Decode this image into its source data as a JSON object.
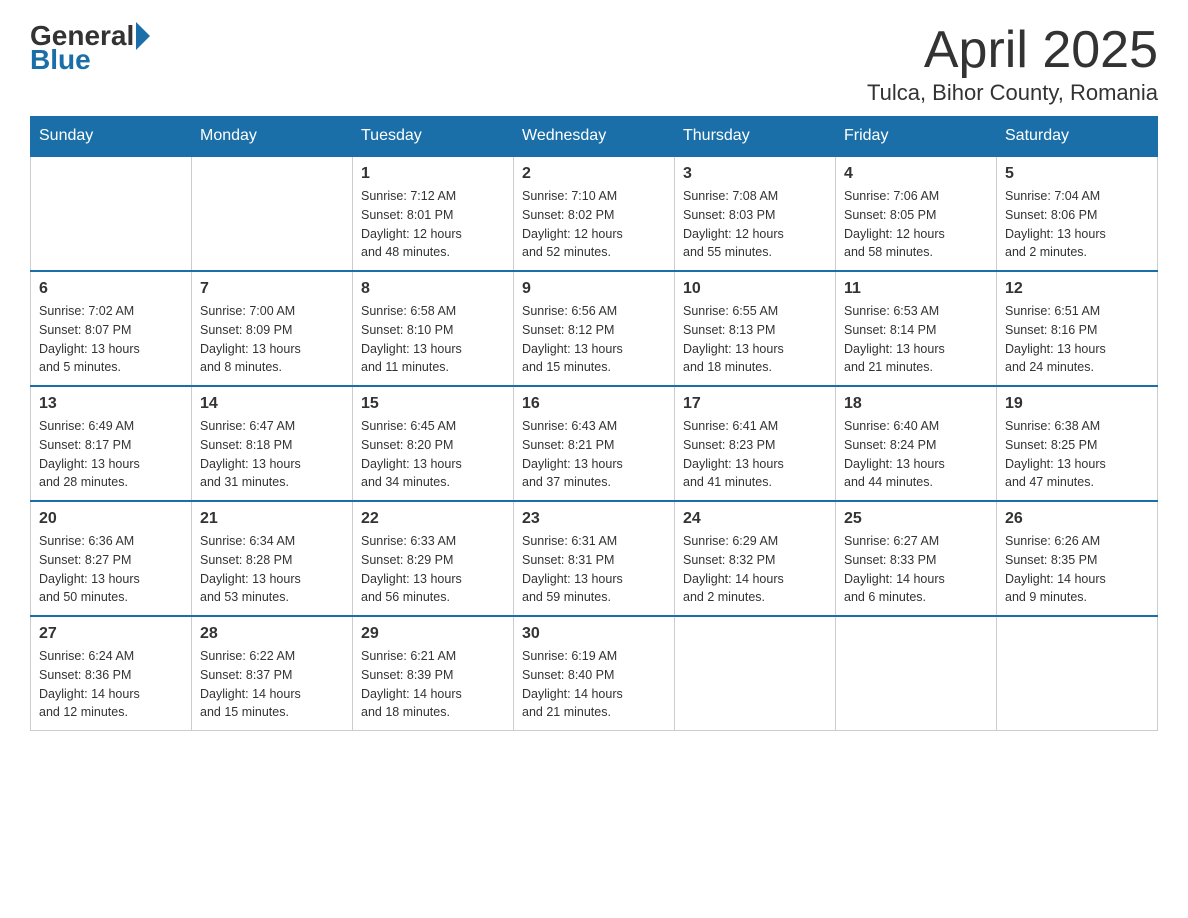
{
  "header": {
    "logo_general": "General",
    "logo_blue": "Blue",
    "month_title": "April 2025",
    "location": "Tulca, Bihor County, Romania"
  },
  "days_of_week": [
    "Sunday",
    "Monday",
    "Tuesday",
    "Wednesday",
    "Thursday",
    "Friday",
    "Saturday"
  ],
  "weeks": [
    [
      {
        "day": "",
        "info": ""
      },
      {
        "day": "",
        "info": ""
      },
      {
        "day": "1",
        "info": "Sunrise: 7:12 AM\nSunset: 8:01 PM\nDaylight: 12 hours\nand 48 minutes."
      },
      {
        "day": "2",
        "info": "Sunrise: 7:10 AM\nSunset: 8:02 PM\nDaylight: 12 hours\nand 52 minutes."
      },
      {
        "day": "3",
        "info": "Sunrise: 7:08 AM\nSunset: 8:03 PM\nDaylight: 12 hours\nand 55 minutes."
      },
      {
        "day": "4",
        "info": "Sunrise: 7:06 AM\nSunset: 8:05 PM\nDaylight: 12 hours\nand 58 minutes."
      },
      {
        "day": "5",
        "info": "Sunrise: 7:04 AM\nSunset: 8:06 PM\nDaylight: 13 hours\nand 2 minutes."
      }
    ],
    [
      {
        "day": "6",
        "info": "Sunrise: 7:02 AM\nSunset: 8:07 PM\nDaylight: 13 hours\nand 5 minutes."
      },
      {
        "day": "7",
        "info": "Sunrise: 7:00 AM\nSunset: 8:09 PM\nDaylight: 13 hours\nand 8 minutes."
      },
      {
        "day": "8",
        "info": "Sunrise: 6:58 AM\nSunset: 8:10 PM\nDaylight: 13 hours\nand 11 minutes."
      },
      {
        "day": "9",
        "info": "Sunrise: 6:56 AM\nSunset: 8:12 PM\nDaylight: 13 hours\nand 15 minutes."
      },
      {
        "day": "10",
        "info": "Sunrise: 6:55 AM\nSunset: 8:13 PM\nDaylight: 13 hours\nand 18 minutes."
      },
      {
        "day": "11",
        "info": "Sunrise: 6:53 AM\nSunset: 8:14 PM\nDaylight: 13 hours\nand 21 minutes."
      },
      {
        "day": "12",
        "info": "Sunrise: 6:51 AM\nSunset: 8:16 PM\nDaylight: 13 hours\nand 24 minutes."
      }
    ],
    [
      {
        "day": "13",
        "info": "Sunrise: 6:49 AM\nSunset: 8:17 PM\nDaylight: 13 hours\nand 28 minutes."
      },
      {
        "day": "14",
        "info": "Sunrise: 6:47 AM\nSunset: 8:18 PM\nDaylight: 13 hours\nand 31 minutes."
      },
      {
        "day": "15",
        "info": "Sunrise: 6:45 AM\nSunset: 8:20 PM\nDaylight: 13 hours\nand 34 minutes."
      },
      {
        "day": "16",
        "info": "Sunrise: 6:43 AM\nSunset: 8:21 PM\nDaylight: 13 hours\nand 37 minutes."
      },
      {
        "day": "17",
        "info": "Sunrise: 6:41 AM\nSunset: 8:23 PM\nDaylight: 13 hours\nand 41 minutes."
      },
      {
        "day": "18",
        "info": "Sunrise: 6:40 AM\nSunset: 8:24 PM\nDaylight: 13 hours\nand 44 minutes."
      },
      {
        "day": "19",
        "info": "Sunrise: 6:38 AM\nSunset: 8:25 PM\nDaylight: 13 hours\nand 47 minutes."
      }
    ],
    [
      {
        "day": "20",
        "info": "Sunrise: 6:36 AM\nSunset: 8:27 PM\nDaylight: 13 hours\nand 50 minutes."
      },
      {
        "day": "21",
        "info": "Sunrise: 6:34 AM\nSunset: 8:28 PM\nDaylight: 13 hours\nand 53 minutes."
      },
      {
        "day": "22",
        "info": "Sunrise: 6:33 AM\nSunset: 8:29 PM\nDaylight: 13 hours\nand 56 minutes."
      },
      {
        "day": "23",
        "info": "Sunrise: 6:31 AM\nSunset: 8:31 PM\nDaylight: 13 hours\nand 59 minutes."
      },
      {
        "day": "24",
        "info": "Sunrise: 6:29 AM\nSunset: 8:32 PM\nDaylight: 14 hours\nand 2 minutes."
      },
      {
        "day": "25",
        "info": "Sunrise: 6:27 AM\nSunset: 8:33 PM\nDaylight: 14 hours\nand 6 minutes."
      },
      {
        "day": "26",
        "info": "Sunrise: 6:26 AM\nSunset: 8:35 PM\nDaylight: 14 hours\nand 9 minutes."
      }
    ],
    [
      {
        "day": "27",
        "info": "Sunrise: 6:24 AM\nSunset: 8:36 PM\nDaylight: 14 hours\nand 12 minutes."
      },
      {
        "day": "28",
        "info": "Sunrise: 6:22 AM\nSunset: 8:37 PM\nDaylight: 14 hours\nand 15 minutes."
      },
      {
        "day": "29",
        "info": "Sunrise: 6:21 AM\nSunset: 8:39 PM\nDaylight: 14 hours\nand 18 minutes."
      },
      {
        "day": "30",
        "info": "Sunrise: 6:19 AM\nSunset: 8:40 PM\nDaylight: 14 hours\nand 21 minutes."
      },
      {
        "day": "",
        "info": ""
      },
      {
        "day": "",
        "info": ""
      },
      {
        "day": "",
        "info": ""
      }
    ]
  ]
}
